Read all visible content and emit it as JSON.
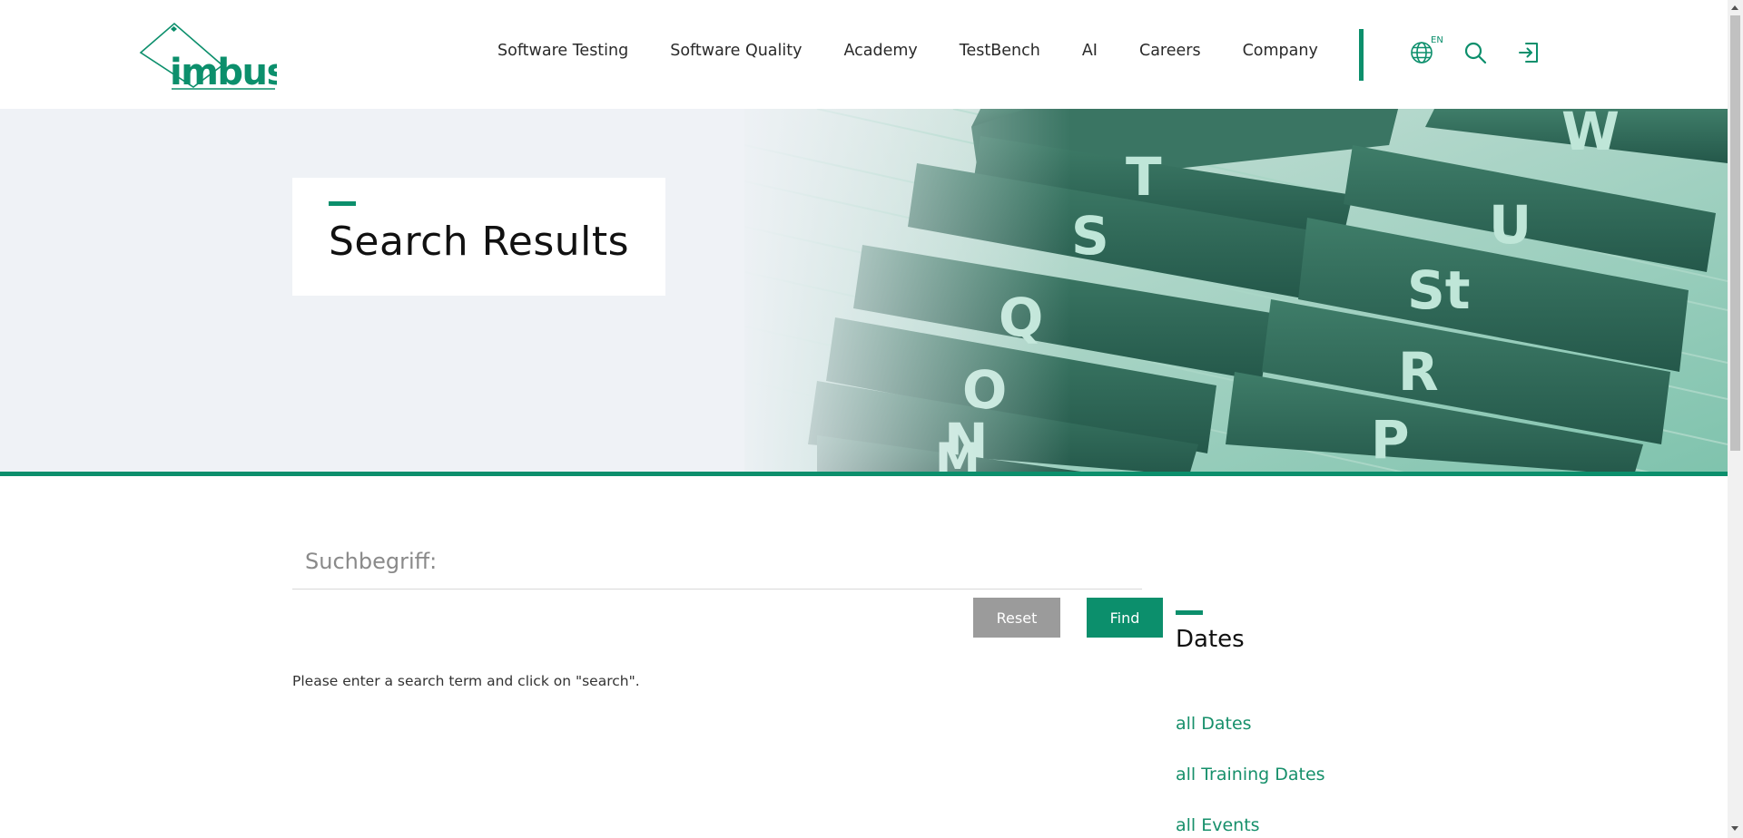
{
  "brand": {
    "name": "imbus",
    "accent": "#0c8f6c"
  },
  "nav": {
    "items": [
      {
        "label": "Software Testing"
      },
      {
        "label": "Software Quality"
      },
      {
        "label": "Academy"
      },
      {
        "label": "TestBench"
      },
      {
        "label": "AI"
      },
      {
        "label": "Careers"
      },
      {
        "label": "Company"
      }
    ],
    "language": "EN",
    "icons": [
      "globe-icon",
      "search-icon",
      "login-icon"
    ]
  },
  "hero": {
    "title": "Search Results",
    "tab_letters": [
      "T",
      "W",
      "S",
      "U",
      "St",
      "Q",
      "R",
      "O",
      "N",
      "P",
      "M"
    ]
  },
  "search": {
    "placeholder": "Suchbegriff:",
    "value": "",
    "reset_label": "Reset",
    "find_label": "Find",
    "hint": "Please enter a search term and click on \"search\"."
  },
  "sidebar": {
    "title": "Dates",
    "links": [
      "all Dates",
      "all Training Dates",
      "all Events"
    ]
  }
}
